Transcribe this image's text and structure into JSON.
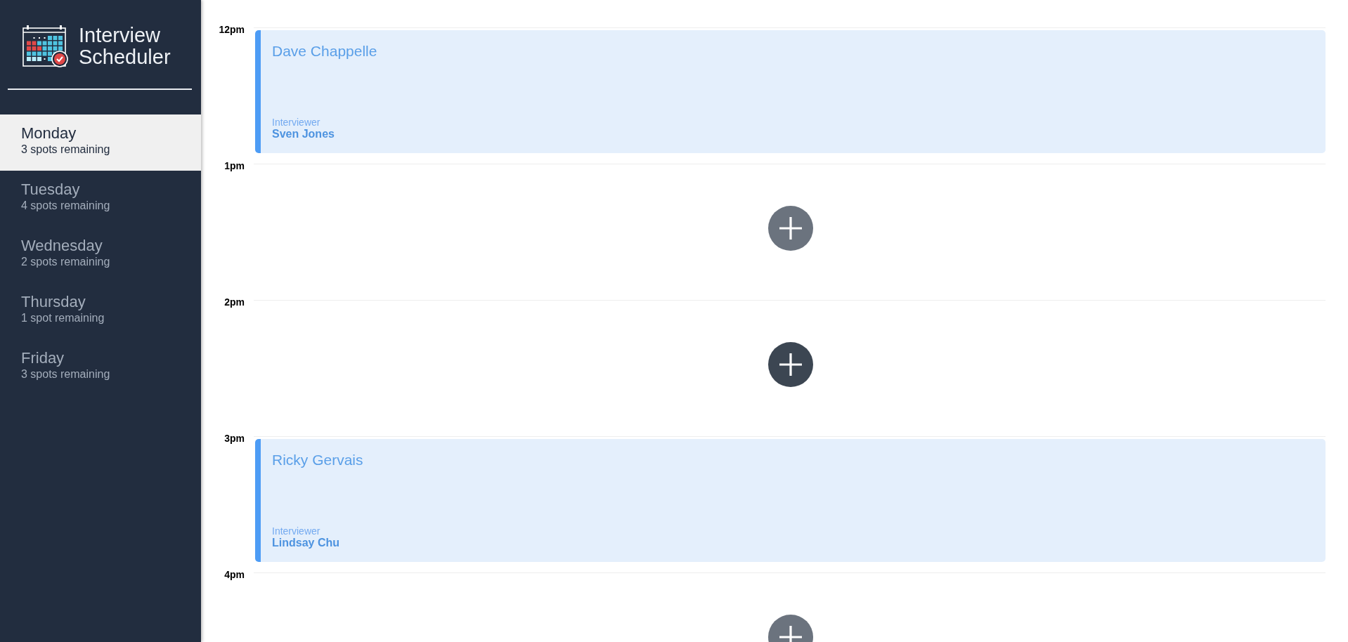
{
  "app": {
    "title_lines": [
      "Interview",
      "Scheduler"
    ]
  },
  "days": [
    {
      "name": "Monday",
      "spots": "3 spots remaining",
      "selected": true
    },
    {
      "name": "Tuesday",
      "spots": "4 spots remaining",
      "selected": false
    },
    {
      "name": "Wednesday",
      "spots": "2 spots remaining",
      "selected": false
    },
    {
      "name": "Thursday",
      "spots": "1 spot remaining",
      "selected": false
    },
    {
      "name": "Friday",
      "spots": "3 spots remaining",
      "selected": false
    }
  ],
  "slots": [
    {
      "time": "12pm",
      "kind": "appointment",
      "student": "Dave Chappelle",
      "interviewer_label": "Interviewer",
      "interviewer": "Sven Jones"
    },
    {
      "time": "1pm",
      "kind": "empty",
      "highlighted": false
    },
    {
      "time": "2pm",
      "kind": "empty",
      "highlighted": true
    },
    {
      "time": "3pm",
      "kind": "appointment",
      "student": "Ricky Gervais",
      "interviewer_label": "Interviewer",
      "interviewer": "Lindsay Chu"
    },
    {
      "time": "4pm",
      "kind": "empty",
      "highlighted": false
    }
  ]
}
